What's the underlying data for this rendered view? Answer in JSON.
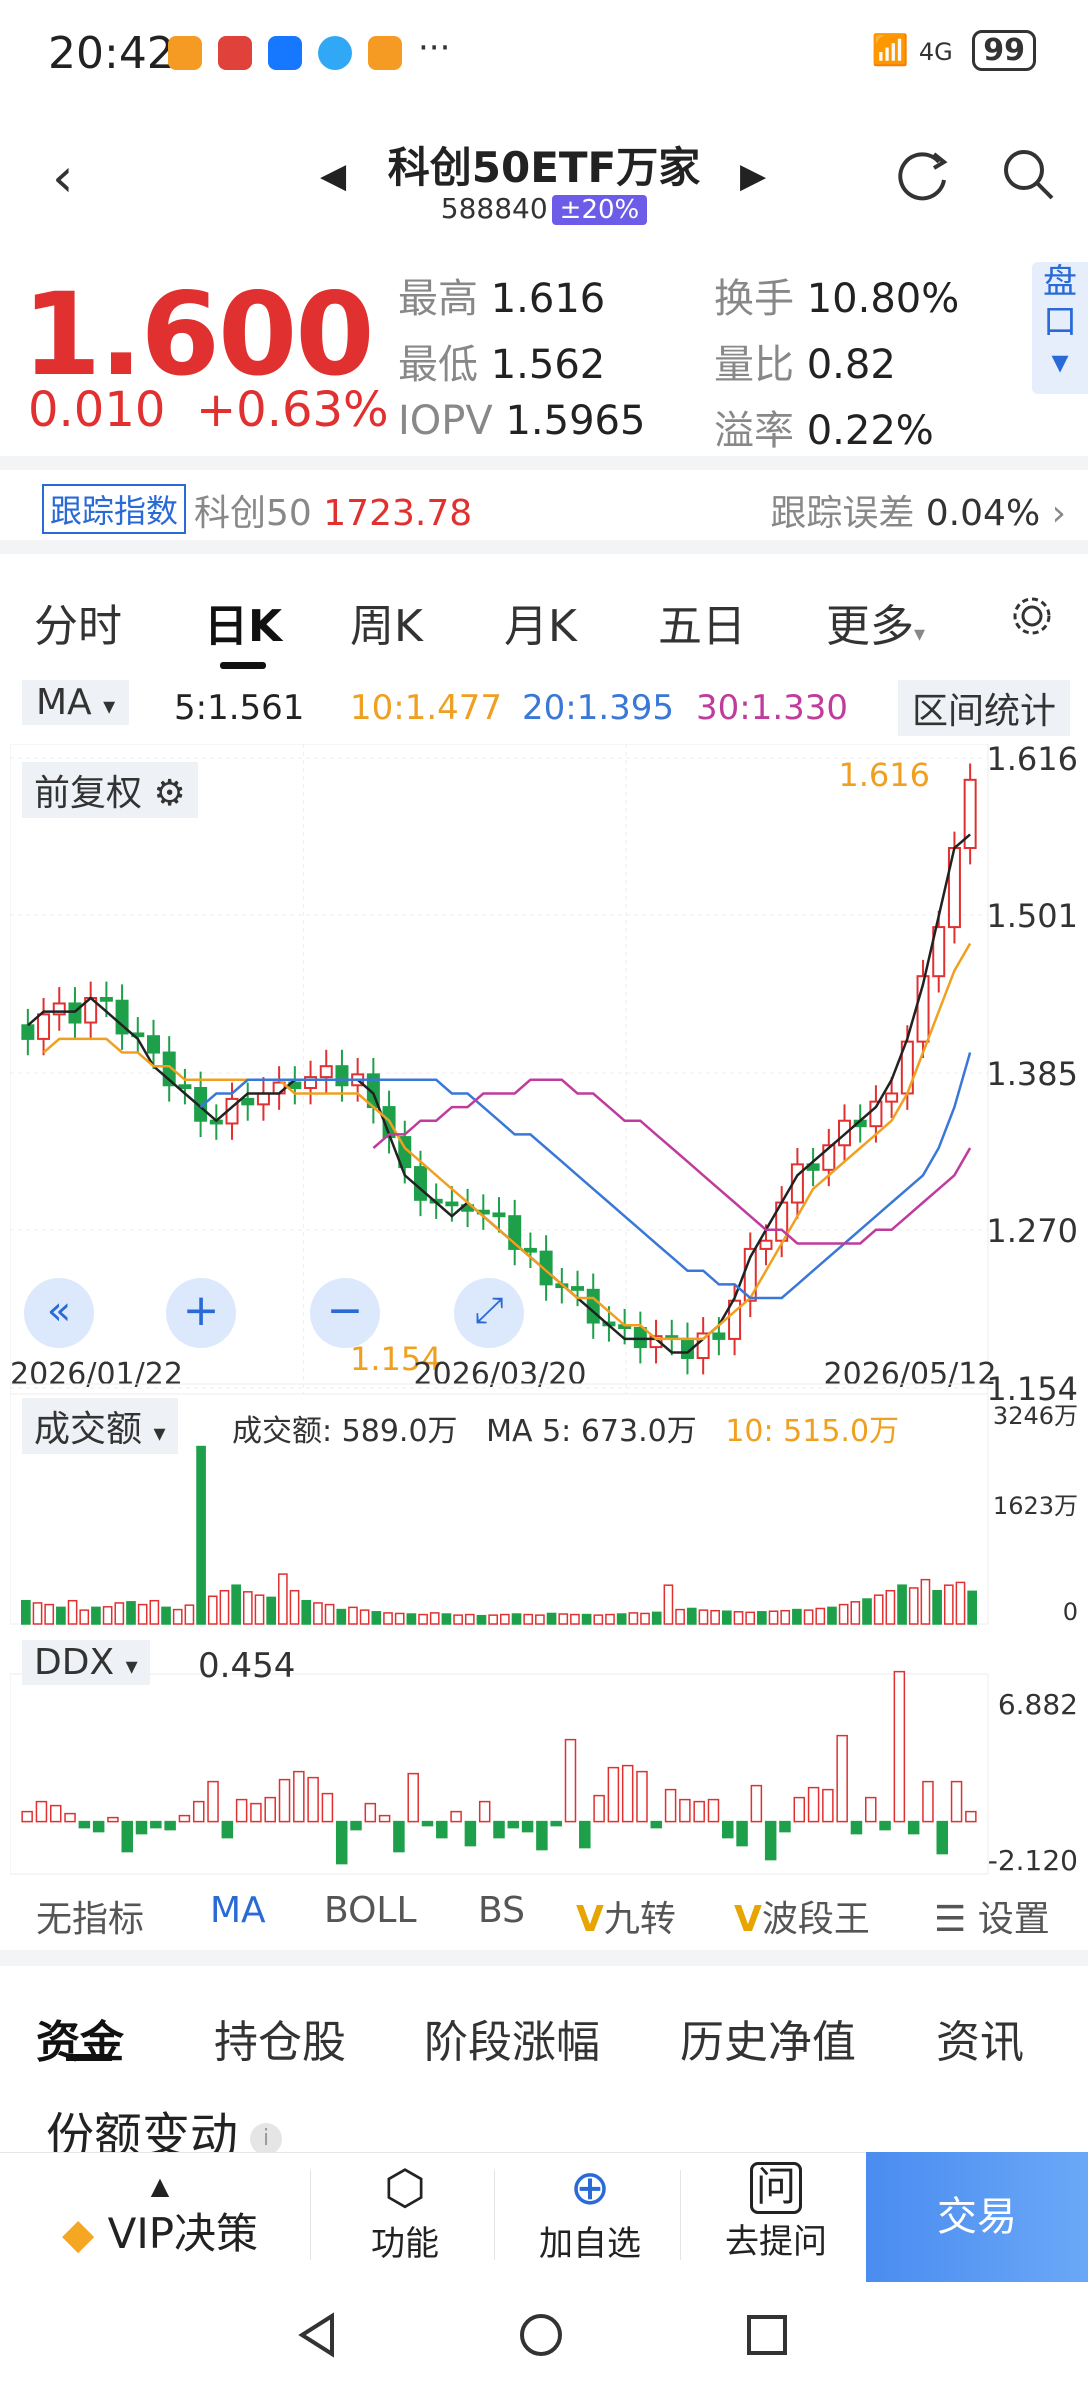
{
  "status_bar": {
    "time": "20:42",
    "network": "4G",
    "battery": "99",
    "more": "···"
  },
  "header": {
    "title": "科创50ETF万家",
    "code": "588840",
    "limit_tag": "±20%"
  },
  "quote": {
    "price": "1.600",
    "change": "0.010",
    "change_pct": "+0.63%",
    "high_label": "最高",
    "high": "1.616",
    "low_label": "最低",
    "low": "1.562",
    "iopv_label": "IOPV",
    "iopv": "1.5965",
    "turnover_label": "换手",
    "turnover": "10.80%",
    "vol_ratio_label": "量比",
    "vol_ratio": "0.82",
    "premium_label": "溢率",
    "premium": "0.22%",
    "pankou": "盘口"
  },
  "tracking": {
    "tag": "跟踪指数",
    "index_name": "科创50",
    "index_value": "1723.78",
    "error_label": "跟踪误差",
    "error_value": "0.04%"
  },
  "kline_tabs": [
    "分时",
    "日K",
    "周K",
    "月K",
    "五日",
    "更多"
  ],
  "ma": {
    "label": "MA",
    "ma5": "5:1.561",
    "ma10": "10:1.477",
    "ma20": "20:1.395",
    "ma30": "30:1.330",
    "zone_button": "区间统计"
  },
  "colors": {
    "up": "#e03030",
    "down": "#1ea04a",
    "ma5": "#222222",
    "ma10": "#f0a020",
    "ma20": "#3a78d8",
    "ma30": "#c03c9c",
    "accent": "#2a6ad6"
  },
  "chart_data": [
    {
      "type": "candlestick",
      "title": "前复权",
      "y_ticks": [
        "1.616",
        "1.501",
        "1.385",
        "1.270",
        "1.154"
      ],
      "ylim": [
        1.154,
        1.616
      ],
      "x_ticks": [
        "2026/01/22",
        "2026/03/20",
        "2026/05/12"
      ],
      "annotations": {
        "max": "1.616",
        "min": "1.154"
      },
      "series": [
        {
          "name": "MA5",
          "values": [
            1.42,
            1.43,
            1.43,
            1.43,
            1.44,
            1.43,
            1.42,
            1.41,
            1.39,
            1.38,
            1.37,
            1.36,
            1.35,
            1.36,
            1.37,
            1.37,
            1.37,
            1.38,
            1.38,
            1.38,
            1.38,
            1.38,
            1.37,
            1.34,
            1.31,
            1.3,
            1.29,
            1.28,
            1.29,
            1.28,
            1.27,
            1.26,
            1.25,
            1.24,
            1.23,
            1.22,
            1.21,
            1.2,
            1.19,
            1.19,
            1.19,
            1.18,
            1.18,
            1.19,
            1.2,
            1.22,
            1.25,
            1.27,
            1.29,
            1.31,
            1.32,
            1.33,
            1.34,
            1.35,
            1.36,
            1.38,
            1.41,
            1.45,
            1.5,
            1.55,
            1.56
          ]
        },
        {
          "name": "MA10",
          "values": [
            1.4,
            1.41,
            1.41,
            1.41,
            1.41,
            1.4,
            1.4,
            1.39,
            1.39,
            1.38,
            1.38,
            1.38,
            1.38,
            1.38,
            1.38,
            1.38,
            1.37,
            1.37,
            1.37,
            1.37,
            1.37,
            1.36,
            1.35,
            1.33,
            1.32,
            1.31,
            1.3,
            1.29,
            1.28,
            1.27,
            1.26,
            1.25,
            1.24,
            1.23,
            1.22,
            1.22,
            1.21,
            1.2,
            1.2,
            1.19,
            1.19,
            1.19,
            1.19,
            1.2,
            1.21,
            1.22,
            1.24,
            1.26,
            1.28,
            1.3,
            1.31,
            1.32,
            1.33,
            1.34,
            1.35,
            1.37,
            1.4,
            1.43,
            1.46,
            1.48
          ]
        },
        {
          "name": "MA20",
          "values": [
            1.36,
            1.37,
            1.37,
            1.38,
            1.38,
            1.38,
            1.38,
            1.38,
            1.38,
            1.38,
            1.38,
            1.38,
            1.38,
            1.38,
            1.38,
            1.38,
            1.37,
            1.37,
            1.36,
            1.35,
            1.34,
            1.34,
            1.33,
            1.32,
            1.31,
            1.3,
            1.29,
            1.28,
            1.27,
            1.26,
            1.25,
            1.24,
            1.24,
            1.23,
            1.23,
            1.22,
            1.22,
            1.22,
            1.23,
            1.24,
            1.25,
            1.26,
            1.27,
            1.28,
            1.29,
            1.3,
            1.31,
            1.33,
            1.36,
            1.4
          ]
        },
        {
          "name": "MA30",
          "values": [
            1.33,
            1.34,
            1.34,
            1.35,
            1.35,
            1.36,
            1.36,
            1.37,
            1.37,
            1.37,
            1.38,
            1.38,
            1.38,
            1.37,
            1.37,
            1.36,
            1.35,
            1.35,
            1.34,
            1.33,
            1.32,
            1.31,
            1.3,
            1.29,
            1.28,
            1.27,
            1.27,
            1.26,
            1.26,
            1.26,
            1.26,
            1.26,
            1.27,
            1.27,
            1.28,
            1.29,
            1.3,
            1.31,
            1.33
          ]
        }
      ]
    },
    {
      "type": "bar",
      "title": "成交额",
      "legend": {
        "amount_label": "成交额:",
        "amount": "589.0万",
        "ma5_label": "MA 5:",
        "ma5": "673.0万",
        "ma10_label": "10:",
        "ma10": "515.0万"
      },
      "y_ticks": [
        "3246万",
        "1623万",
        "0"
      ],
      "ylim": [
        0,
        3246
      ],
      "values": [
        420,
        380,
        350,
        300,
        420,
        250,
        300,
        310,
        380,
        400,
        350,
        420,
        300,
        260,
        340,
        3200,
        500,
        600,
        700,
        580,
        520,
        480,
        900,
        600,
        420,
        380,
        350,
        260,
        300,
        250,
        220,
        200,
        190,
        180,
        170,
        200,
        180,
        160,
        170,
        150,
        160,
        170,
        180,
        170,
        160,
        190,
        180,
        170,
        170,
        160,
        170,
        180,
        200,
        190,
        210,
        700,
        260,
        280,
        250,
        240,
        230,
        220,
        210,
        220,
        230,
        240,
        260,
        250,
        280,
        300,
        350,
        400,
        450,
        520,
        600,
        700,
        650,
        800,
        600,
        700,
        750,
        589
      ]
    },
    {
      "type": "bar",
      "title": "DDX",
      "value": "0.454",
      "y_ticks": [
        "6.882",
        "-2.120"
      ],
      "ylim": [
        -2.12,
        6.882
      ],
      "values": [
        0.5,
        1.0,
        0.8,
        0.4,
        -0.3,
        -0.5,
        0.2,
        -1.5,
        -0.6,
        -0.3,
        -0.4,
        0.3,
        1.0,
        2.0,
        -0.8,
        1.1,
        0.9,
        1.2,
        2.1,
        2.5,
        2.2,
        1.4,
        -2.1,
        -0.4,
        0.9,
        0.3,
        -1.5,
        2.4,
        -0.2,
        -0.8,
        0.5,
        -1.2,
        1.0,
        -0.8,
        -0.3,
        -0.5,
        -1.4,
        -0.2,
        4.1,
        -1.3,
        1.3,
        2.7,
        2.8,
        2.5,
        -0.3,
        1.6,
        1.1,
        1.0,
        1.1,
        -0.8,
        -1.2,
        1.8,
        -1.9,
        -0.5,
        1.2,
        1.7,
        1.6,
        4.3,
        -0.6,
        1.2,
        -0.4,
        7.5,
        -0.6,
        2.0,
        -1.6,
        2.0,
        0.5
      ]
    }
  ],
  "indicator_tabs": [
    "无指标",
    "MA",
    "BOLL",
    "BS",
    "九转",
    "波段王",
    "设置"
  ],
  "section_tabs": [
    "资金",
    "持仓股",
    "阶段涨幅",
    "历史净值",
    "资讯"
  ],
  "share_change": {
    "title": "份额变动"
  },
  "toolbar": {
    "vip": "VIP决策",
    "func": "功能",
    "add": "加自选",
    "ask": "去提问",
    "trade": "交易"
  }
}
